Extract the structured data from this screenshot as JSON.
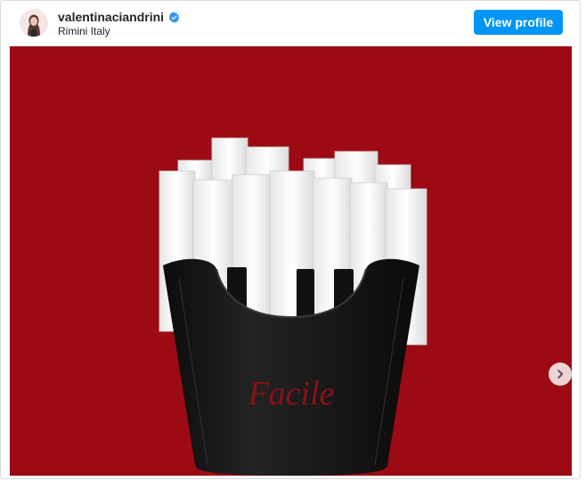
{
  "post": {
    "username": "valentinaciandrini",
    "location": "Rimini Italy",
    "verified": true,
    "view_profile_label": "View profile"
  },
  "media": {
    "background_color": "#9c0b14",
    "container_text": "Facile",
    "next_icon": "chevron-right-icon"
  },
  "colors": {
    "accent": "#0095f6",
    "verified_badge": "#3897f0"
  }
}
